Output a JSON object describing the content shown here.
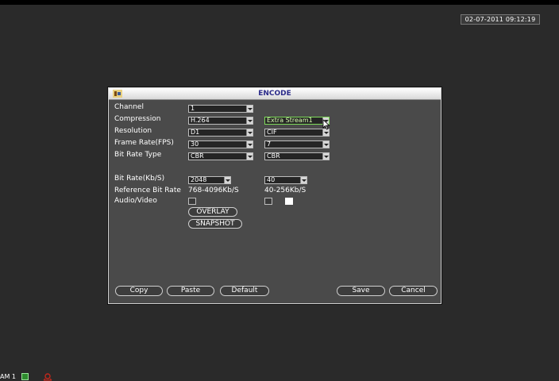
{
  "status": {
    "datetime": "02-07-2011 09:12:19",
    "channel_label": "AM 1"
  },
  "window": {
    "title": "ENCODE"
  },
  "labels": {
    "channel": "Channel",
    "compression": "Compression",
    "resolution": "Resolution",
    "frame_rate": "Frame Rate(FPS)",
    "bit_rate_type": "Bit Rate Type",
    "bit_rate": "Bit Rate(Kb/S)",
    "reference_bit_rate": "Reference Bit Rate",
    "audio_video": "Audio/Video"
  },
  "main_stream": {
    "channel": "1",
    "compression": "H.264",
    "resolution": "D1",
    "frame_rate": "30",
    "bit_rate_type": "CBR",
    "bit_rate": "2048",
    "reference_bit_rate": "768-4096Kb/S"
  },
  "extra_stream": {
    "stream": "Extra Stream1",
    "resolution": "CIF",
    "frame_rate": "7",
    "bit_rate_type": "CBR",
    "bit_rate": "40",
    "reference_bit_rate": "40-256Kb/S"
  },
  "buttons": {
    "overlay": "OVERLAY",
    "snapshot": "SNAPSHOT",
    "copy": "Copy",
    "paste": "Paste",
    "default": "Default",
    "save": "Save",
    "cancel": "Cancel"
  },
  "colors": {
    "highlight": "#7fdc5a",
    "title_text": "#2b2b8a",
    "window_bg": "#4a4a4a"
  }
}
